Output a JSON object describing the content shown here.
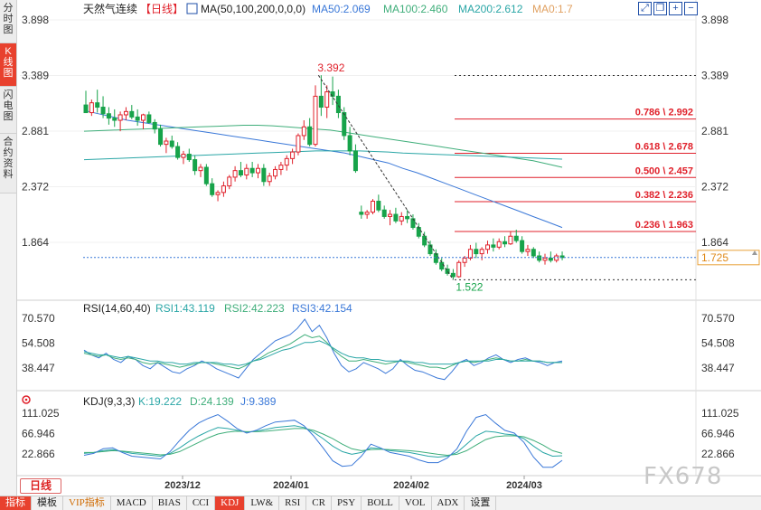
{
  "sidebar": {
    "tabs": [
      {
        "label": "分时图",
        "active": false
      },
      {
        "label": "K线图",
        "active": true
      },
      {
        "label": "闪电图",
        "active": false
      },
      {
        "label": "合约资料",
        "active": false
      }
    ]
  },
  "window_icons": [
    "expand-icon",
    "restore-icon",
    "plus-icon",
    "minus-icon"
  ],
  "main": {
    "instrument": "天然气连续",
    "period": "【日线】",
    "ma_label": "MA(50,100,200,0,0,0)",
    "ma50": "MA50:2.069",
    "ma100": "MA100:2.460",
    "ma200": "MA200:2.612",
    "ma0": "MA0:1.7",
    "high_label": "3.392",
    "low_label": "1.522",
    "last_price": "1.725",
    "fib_labels": [
      "0.786 \\ 2.992",
      "0.618 \\ 2.678",
      "0.500 \\ 2.457",
      "0.382 \\ 2.236",
      "0.236 \\ 1.963"
    ]
  },
  "rsi": {
    "title": "RSI(14,60,40)",
    "rsi1": "RSI1:43.119",
    "rsi2": "RSI2:42.223",
    "rsi3": "RSI3:42.154"
  },
  "kdj": {
    "title": "KDJ(9,3,3)",
    "k": "K:19.222",
    "d": "D:24.139",
    "j": "J:9.389"
  },
  "day_button": "日线",
  "watermark": "FX678",
  "bottom_tabs": [
    {
      "label": "指标",
      "style": "sel"
    },
    {
      "label": "模板",
      "style": ""
    },
    {
      "label": "VIP指标",
      "style": "vip"
    },
    {
      "label": "MACD",
      "style": ""
    },
    {
      "label": "BIAS",
      "style": ""
    },
    {
      "label": "CCI",
      "style": ""
    },
    {
      "label": "KDJ",
      "style": "hl"
    },
    {
      "label": "LW&",
      "style": ""
    },
    {
      "label": "RSI",
      "style": ""
    },
    {
      "label": "CR",
      "style": ""
    },
    {
      "label": "PSY",
      "style": ""
    },
    {
      "label": "BOLL",
      "style": ""
    },
    {
      "label": "VOL",
      "style": ""
    },
    {
      "label": "ADX",
      "style": ""
    },
    {
      "label": "设置",
      "style": ""
    }
  ],
  "colors": {
    "up": "#e0212b",
    "down": "#17a34a",
    "ma50": "#3a78d8",
    "ma100": "#3fae7a",
    "ma200": "#2aa6a6",
    "fib": "#e0212b",
    "k": "#2aa6a6",
    "d": "#3fae7a",
    "j": "#3a78d8"
  },
  "chart_data": [
    {
      "type": "candlestick",
      "title": "天然气连续【日线】",
      "y_ticks": [
        3.898,
        3.389,
        2.881,
        2.372,
        1.864
      ],
      "ylim": [
        1.4,
        4.0
      ],
      "x_ticks": [
        "2023/12",
        "2024/01",
        "2024/02",
        "2024/03"
      ],
      "candles": [
        [
          3.12,
          3.25,
          3.05,
          3.05
        ],
        [
          3.05,
          3.17,
          3.02,
          3.14
        ],
        [
          3.14,
          3.26,
          3.05,
          3.1
        ],
        [
          3.1,
          3.2,
          3.0,
          3.04
        ],
        [
          3.04,
          3.1,
          2.94,
          3.0
        ],
        [
          3.0,
          3.08,
          2.92,
          2.98
        ],
        [
          2.98,
          3.06,
          2.88,
          3.03
        ],
        [
          3.03,
          3.1,
          2.98,
          3.06
        ],
        [
          3.06,
          3.12,
          2.99,
          3.01
        ],
        [
          3.01,
          3.08,
          2.93,
          2.98
        ],
        [
          2.98,
          3.04,
          2.9,
          3.03
        ],
        [
          3.03,
          3.06,
          2.95,
          2.96
        ],
        [
          2.96,
          2.99,
          2.86,
          2.9
        ],
        [
          2.9,
          2.94,
          2.74,
          2.76
        ],
        [
          2.76,
          2.82,
          2.68,
          2.79
        ],
        [
          2.79,
          2.84,
          2.72,
          2.74
        ],
        [
          2.74,
          2.78,
          2.62,
          2.64
        ],
        [
          2.64,
          2.7,
          2.58,
          2.67
        ],
        [
          2.67,
          2.72,
          2.6,
          2.62
        ],
        [
          2.62,
          2.66,
          2.48,
          2.52
        ],
        [
          2.52,
          2.58,
          2.46,
          2.55
        ],
        [
          2.55,
          2.58,
          2.38,
          2.4
        ],
        [
          2.4,
          2.45,
          2.28,
          2.3
        ],
        [
          2.3,
          2.34,
          2.24,
          2.32
        ],
        [
          2.32,
          2.42,
          2.28,
          2.38
        ],
        [
          2.38,
          2.48,
          2.35,
          2.46
        ],
        [
          2.46,
          2.56,
          2.42,
          2.52
        ],
        [
          2.52,
          2.6,
          2.46,
          2.48
        ],
        [
          2.48,
          2.58,
          2.44,
          2.54
        ],
        [
          2.54,
          2.6,
          2.46,
          2.5
        ],
        [
          2.5,
          2.58,
          2.45,
          2.54
        ],
        [
          2.54,
          2.58,
          2.38,
          2.42
        ],
        [
          2.42,
          2.5,
          2.38,
          2.47
        ],
        [
          2.47,
          2.56,
          2.44,
          2.53
        ],
        [
          2.53,
          2.6,
          2.48,
          2.57
        ],
        [
          2.57,
          2.66,
          2.52,
          2.63
        ],
        [
          2.63,
          2.72,
          2.58,
          2.69
        ],
        [
          2.69,
          2.86,
          2.66,
          2.84
        ],
        [
          2.84,
          2.98,
          2.8,
          2.92
        ],
        [
          2.92,
          3.0,
          2.74,
          2.76
        ],
        [
          2.76,
          3.3,
          2.74,
          3.2
        ],
        [
          3.2,
          3.392,
          3.02,
          3.1
        ],
        [
          3.1,
          3.3,
          3.0,
          3.24
        ],
        [
          3.24,
          3.38,
          3.12,
          3.2
        ],
        [
          3.2,
          3.26,
          3.0,
          3.05
        ],
        [
          3.05,
          3.1,
          2.8,
          2.84
        ],
        [
          2.84,
          2.92,
          2.66,
          2.7
        ],
        [
          2.7,
          2.76,
          2.5,
          2.52
        ],
        [
          2.14,
          2.2,
          2.08,
          2.12
        ],
        [
          2.12,
          2.16,
          2.08,
          2.14
        ],
        [
          2.14,
          2.26,
          2.12,
          2.24
        ],
        [
          2.24,
          2.3,
          2.14,
          2.16
        ],
        [
          2.16,
          2.2,
          2.08,
          2.1
        ],
        [
          2.1,
          2.16,
          2.02,
          2.12
        ],
        [
          2.12,
          2.18,
          2.04,
          2.06
        ],
        [
          2.06,
          2.14,
          2.02,
          2.1
        ],
        [
          2.1,
          2.16,
          2.04,
          2.08
        ],
        [
          2.08,
          2.12,
          1.98,
          2.0
        ],
        [
          2.0,
          2.04,
          1.9,
          1.92
        ],
        [
          1.92,
          1.96,
          1.82,
          1.84
        ],
        [
          1.84,
          1.88,
          1.74,
          1.76
        ],
        [
          1.76,
          1.8,
          1.66,
          1.68
        ],
        [
          1.68,
          1.72,
          1.6,
          1.62
        ],
        [
          1.62,
          1.66,
          1.56,
          1.58
        ],
        [
          1.58,
          1.62,
          1.522,
          1.55
        ],
        [
          1.55,
          1.7,
          1.54,
          1.68
        ],
        [
          1.68,
          1.74,
          1.64,
          1.72
        ],
        [
          1.72,
          1.84,
          1.7,
          1.8
        ],
        [
          1.8,
          1.86,
          1.72,
          1.76
        ],
        [
          1.76,
          1.82,
          1.7,
          1.8
        ],
        [
          1.8,
          1.88,
          1.76,
          1.84
        ],
        [
          1.84,
          1.9,
          1.78,
          1.82
        ],
        [
          1.82,
          1.9,
          1.8,
          1.87
        ],
        [
          1.87,
          1.92,
          1.82,
          1.85
        ],
        [
          1.85,
          1.96,
          1.84,
          1.92
        ],
        [
          1.92,
          1.98,
          1.86,
          1.88
        ],
        [
          1.88,
          1.92,
          1.76,
          1.78
        ],
        [
          1.78,
          1.84,
          1.74,
          1.8
        ],
        [
          1.8,
          1.82,
          1.72,
          1.74
        ],
        [
          1.74,
          1.78,
          1.68,
          1.7
        ],
        [
          1.7,
          1.76,
          1.66,
          1.72
        ],
        [
          1.72,
          1.78,
          1.68,
          1.7
        ],
        [
          1.7,
          1.76,
          1.68,
          1.74
        ],
        [
          1.74,
          1.78,
          1.7,
          1.725
        ]
      ],
      "ma50": [
        3.07,
        3.04,
        3.01,
        2.98,
        2.96,
        2.94,
        2.92,
        2.9,
        2.88,
        2.86,
        2.84,
        2.82,
        2.8,
        2.78,
        2.76,
        2.74,
        2.72,
        2.7,
        2.68,
        2.65,
        2.62,
        2.59,
        2.54,
        2.5,
        2.45,
        2.4,
        2.35,
        2.3,
        2.25,
        2.2,
        2.15,
        2.1,
        2.05,
        2.0
      ],
      "ma100": [
        2.88,
        2.885,
        2.89,
        2.895,
        2.9,
        2.905,
        2.91,
        2.915,
        2.92,
        2.925,
        2.93,
        2.935,
        2.935,
        2.93,
        2.92,
        2.91,
        2.9,
        2.89,
        2.87,
        2.85,
        2.83,
        2.81,
        2.79,
        2.77,
        2.75,
        2.73,
        2.71,
        2.69,
        2.67,
        2.65,
        2.63,
        2.61,
        2.58,
        2.55
      ],
      "ma200": [
        2.62,
        2.625,
        2.63,
        2.635,
        2.64,
        2.645,
        2.65,
        2.655,
        2.66,
        2.665,
        2.67,
        2.675,
        2.68,
        2.685,
        2.69,
        2.695,
        2.7,
        2.7,
        2.7,
        2.7,
        2.695,
        2.69,
        2.68,
        2.675,
        2.67,
        2.665,
        2.66,
        2.655,
        2.65,
        2.645,
        2.64,
        2.635,
        2.63,
        2.625
      ],
      "fib": [
        {
          "ratio": "0.786",
          "value": 2.992
        },
        {
          "ratio": "0.618",
          "value": 2.678
        },
        {
          "ratio": "0.500",
          "value": 2.457
        },
        {
          "ratio": "0.382",
          "value": 2.236
        },
        {
          "ratio": "0.236",
          "value": 1.963
        }
      ],
      "high": 3.392,
      "low": 1.522,
      "last": 1.725
    },
    {
      "type": "line",
      "title": "RSI(14,60,40)",
      "y_ticks": [
        70.57,
        54.508,
        38.447
      ],
      "ylim": [
        25,
        80
      ],
      "series": [
        {
          "name": "RSI1",
          "values": [
            50,
            47,
            45,
            48,
            44,
            42,
            46,
            44,
            40,
            38,
            42,
            39,
            36,
            35,
            38,
            40,
            43,
            41,
            38,
            36,
            34,
            32,
            38,
            44,
            48,
            52,
            56,
            58,
            60,
            64,
            70,
            62,
            66,
            58,
            48,
            40,
            36,
            38,
            42,
            40,
            38,
            35,
            38,
            44,
            40,
            37,
            36,
            34,
            32,
            31,
            36,
            42,
            44,
            40,
            42,
            45,
            47,
            44,
            42,
            44,
            45,
            43,
            42,
            40,
            42,
            43
          ]
        },
        {
          "name": "RSI2",
          "values": [
            48,
            47,
            46,
            47,
            45,
            44,
            45,
            44,
            42,
            41,
            42,
            41,
            40,
            39,
            40,
            41,
            42,
            42,
            41,
            40,
            39,
            38,
            40,
            43,
            45,
            48,
            50,
            52,
            54,
            57,
            60,
            58,
            59,
            55,
            50,
            46,
            43,
            43,
            44,
            43,
            42,
            41,
            42,
            43,
            42,
            41,
            40,
            39,
            39,
            38,
            40,
            42,
            43,
            42,
            43,
            44,
            45,
            44,
            43,
            43,
            44,
            43,
            43,
            42,
            42,
            42
          ]
        },
        {
          "name": "RSI3",
          "values": [
            49,
            48,
            47,
            47,
            46,
            45,
            46,
            45,
            44,
            43,
            43,
            42,
            42,
            41,
            41,
            42,
            42,
            42,
            42,
            41,
            41,
            40,
            41,
            43,
            44,
            46,
            48,
            50,
            51,
            53,
            55,
            55,
            56,
            54,
            51,
            48,
            46,
            45,
            45,
            44,
            44,
            43,
            43,
            43,
            43,
            42,
            42,
            41,
            41,
            41,
            41,
            42,
            43,
            43,
            43,
            43,
            44,
            44,
            43,
            43,
            43,
            43,
            43,
            42,
            42,
            42
          ]
        }
      ]
    },
    {
      "type": "line",
      "title": "KDJ(9,3,3)",
      "y_ticks": [
        111.025,
        66.946,
        22.866
      ],
      "ylim": [
        -20,
        130
      ],
      "series": [
        {
          "name": "K",
          "values": [
            24,
            26,
            30,
            32,
            28,
            24,
            22,
            20,
            18,
            24,
            36,
            50,
            62,
            72,
            80,
            78,
            74,
            70,
            72,
            76,
            80,
            82,
            84,
            80,
            70,
            56,
            40,
            28,
            22,
            26,
            36,
            34,
            30,
            28,
            26,
            22,
            18,
            16,
            18,
            26,
            44,
            62,
            72,
            70,
            66,
            64,
            56,
            40,
            26,
            18,
            19
          ]
        },
        {
          "name": "D",
          "values": [
            26,
            26,
            28,
            30,
            29,
            27,
            25,
            23,
            21,
            22,
            28,
            38,
            48,
            58,
            66,
            70,
            72,
            71,
            71,
            72,
            74,
            76,
            78,
            78,
            74,
            66,
            56,
            44,
            34,
            30,
            32,
            33,
            32,
            31,
            30,
            28,
            25,
            22,
            20,
            22,
            30,
            42,
            54,
            60,
            62,
            62,
            60,
            52,
            42,
            30,
            24
          ]
        },
        {
          "name": "J",
          "values": [
            20,
            24,
            34,
            36,
            26,
            18,
            16,
            14,
            12,
            28,
            52,
            74,
            90,
            100,
            108,
            94,
            78,
            68,
            74,
            84,
            92,
            94,
            96,
            84,
            62,
            36,
            8,
            -4,
            -2,
            18,
            44,
            36,
            26,
            22,
            18,
            10,
            4,
            4,
            14,
            34,
            72,
            102,
            108,
            90,
            74,
            68,
            48,
            16,
            -6,
            -6,
            9
          ]
        }
      ]
    }
  ]
}
